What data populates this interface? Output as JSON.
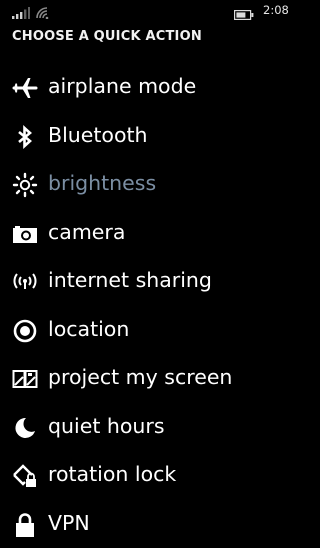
{
  "status_bar": {
    "time": "2:08",
    "icons": [
      "signal-icon",
      "wifi-icon",
      "battery-icon"
    ]
  },
  "header": {
    "title": "CHOOSE A QUICK ACTION"
  },
  "actions": [
    {
      "label": "airplane mode",
      "icon": "airplane-icon"
    },
    {
      "label": "Bluetooth",
      "icon": "bluetooth-icon"
    },
    {
      "label": "brightness",
      "icon": "brightness-icon",
      "dimmed": true
    },
    {
      "label": "camera",
      "icon": "camera-icon"
    },
    {
      "label": "internet sharing",
      "icon": "internet-sharing-icon"
    },
    {
      "label": "location",
      "icon": "location-icon"
    },
    {
      "label": "project my screen",
      "icon": "project-screen-icon"
    },
    {
      "label": "quiet hours",
      "icon": "moon-icon"
    },
    {
      "label": "rotation lock",
      "icon": "rotation-lock-icon"
    },
    {
      "label": "VPN",
      "icon": "lock-icon"
    }
  ],
  "colors": {
    "background": "#000000",
    "text": "#ffffff",
    "dimmed_text": "#7b8ea3"
  }
}
